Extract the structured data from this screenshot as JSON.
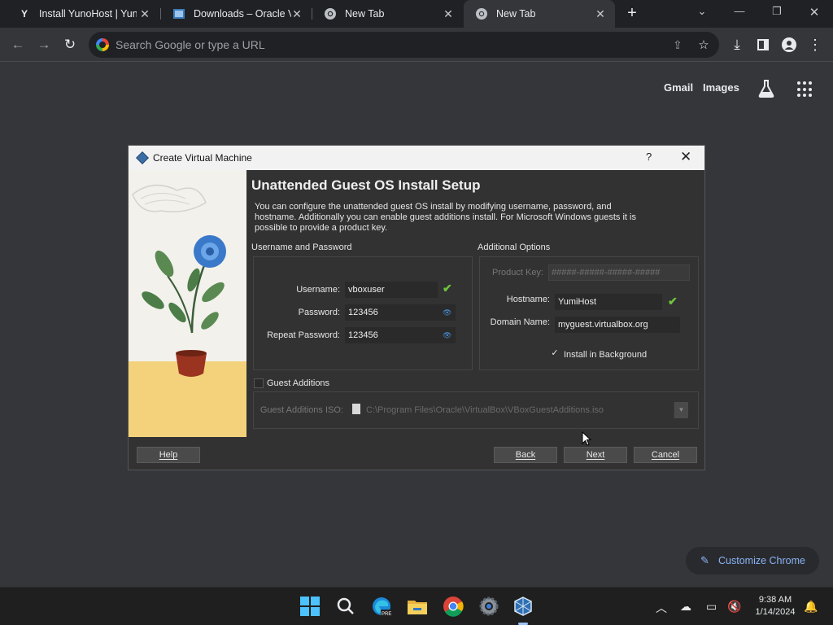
{
  "browser": {
    "tabs": [
      {
        "title": "Install YunoHost | Yuno",
        "favicon": "yunohost-icon",
        "active": false
      },
      {
        "title": "Downloads – Oracle VM",
        "favicon": "virtualbox-icon",
        "active": false
      },
      {
        "title": "New Tab",
        "favicon": "chrome-icon",
        "active": false
      },
      {
        "title": "New Tab",
        "favicon": "chrome-icon",
        "active": true
      }
    ],
    "omnibox_placeholder": "Search Google or type a URL"
  },
  "ntp": {
    "gmail_label": "Gmail",
    "images_label": "Images",
    "customize_label": "Customize Chrome"
  },
  "dialog": {
    "window_title": "Create Virtual Machine",
    "heading": "Unattended Guest OS Install Setup",
    "description": "You can configure the unattended guest OS install by modifying username, password, and hostname. Additionally you can enable guest additions install. For Microsoft Windows guests it is possible to provide a product key.",
    "user_group": {
      "label": "Username and Password",
      "username_label": "Username:",
      "username_value": "vboxuser",
      "password_label": "Password:",
      "password_value": "123456",
      "repeat_label": "Repeat Password:",
      "repeat_value": "123456"
    },
    "additional": {
      "label": "Additional Options",
      "product_key_label": "Product Key:",
      "product_key_placeholder": "#####-#####-#####-#####",
      "hostname_label": "Hostname:",
      "hostname_value": "YumiHost",
      "domain_label": "Domain Name:",
      "domain_value": "myguest.virtualbox.org",
      "install_bg_label": "Install in Background",
      "install_bg_checked": true
    },
    "guest_additions": {
      "label": "Guest Additions",
      "checked": false,
      "iso_label": "Guest Additions ISO:",
      "iso_value": "C:\\Program Files\\Oracle\\VirtualBox\\VBoxGuestAdditions.iso"
    },
    "buttons": {
      "help": "Help",
      "back": "Back",
      "next": "Next",
      "cancel": "Cancel"
    }
  },
  "taskbar": {
    "time": "9:38 AM",
    "date": "1/14/2024",
    "apps": [
      "windows-start-icon",
      "search-icon",
      "edge-pre-icon",
      "file-explorer-icon",
      "chrome-icon",
      "settings-icon",
      "virtualbox-icon"
    ]
  },
  "colors": {
    "ntp_bg": "#35363a",
    "tabstrip_bg": "#202124",
    "dialog_bg": "#323232",
    "accent_blue": "#8ab4f8",
    "ok_green": "#6ec53c"
  }
}
